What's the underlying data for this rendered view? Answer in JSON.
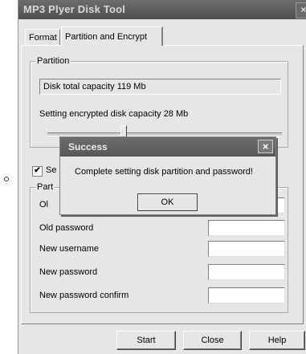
{
  "window": {
    "title": "MP3 Plyer Disk Tool",
    "close_glyph": "×"
  },
  "tabs": [
    {
      "label": "Format"
    },
    {
      "label": "Partition and Encrypt"
    }
  ],
  "partition": {
    "group_label": "Partition",
    "total_capacity": "Disk total capacity 119 Mb",
    "encrypted_capacity": "Setting encrypted disk capacity 28 Mb",
    "slider_fraction": 0.24
  },
  "security": {
    "checkbox_label_partial": "Se",
    "checkbox_checked": "✔",
    "group_label_partial": "Part",
    "old_username_partial": "Ol",
    "old_password": "Old password",
    "new_username": "New username",
    "new_password": "New password",
    "new_password_confirm": "New password confirm"
  },
  "buttons": {
    "start": "Start",
    "close": "Close",
    "help": "Help"
  },
  "popup": {
    "title": "Success",
    "close_glyph": "×",
    "message": "Complete setting disk partition and password!",
    "ok": "OK"
  },
  "colors": {
    "titlebar": "#5c5c5c",
    "dialog_bg": "#e6e6e6"
  }
}
